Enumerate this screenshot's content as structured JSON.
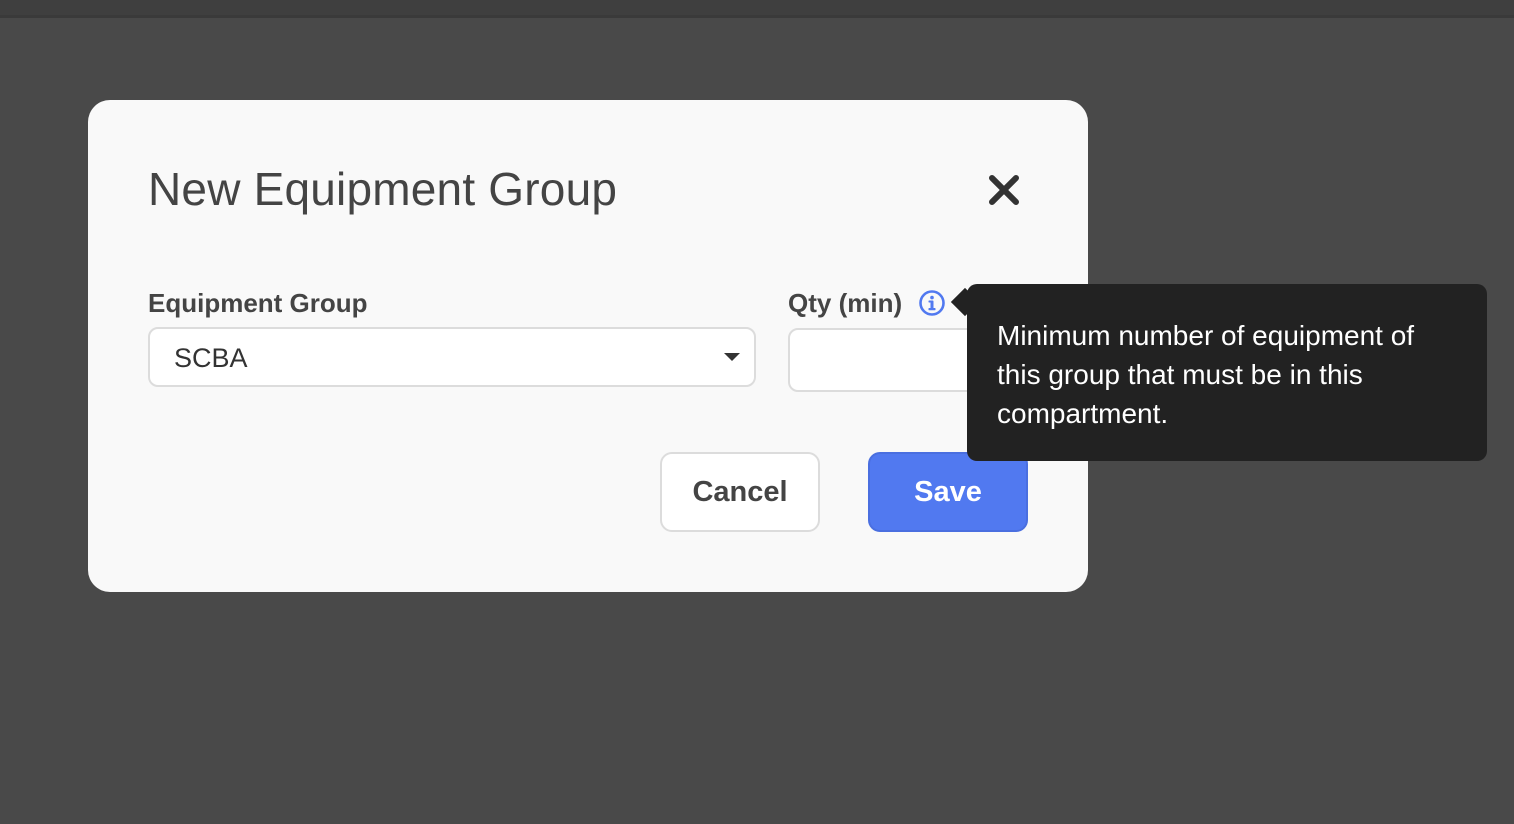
{
  "dialog": {
    "title": "New Equipment Group",
    "close_icon": "close-icon",
    "equipment_group": {
      "label": "Equipment Group",
      "value": "SCBA",
      "caret_icon": "caret-down-icon"
    },
    "qty": {
      "label": "Qty (min)",
      "value": "",
      "placeholder": "",
      "info_icon": "info-icon"
    },
    "buttons": {
      "cancel_label": "Cancel",
      "save_label": "Save"
    }
  },
  "tooltip": {
    "text": "Minimum number of equipment of this group that must be in this compartment."
  },
  "colors": {
    "primary": "#5179f0",
    "backdrop": "#494949",
    "tooltip_bg": "#222222",
    "info_icon": "#5179f0"
  }
}
